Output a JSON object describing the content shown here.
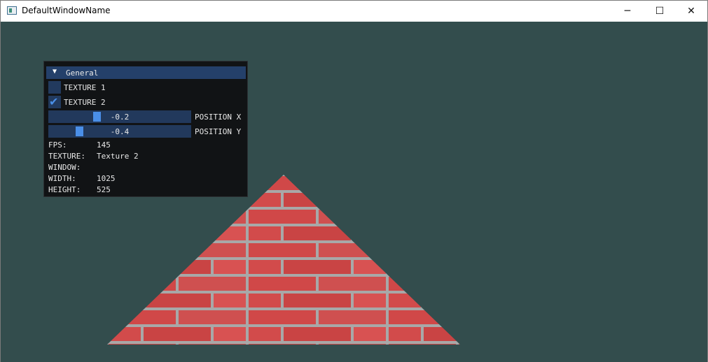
{
  "window": {
    "title": "DefaultWindowName",
    "min_glyph": "─",
    "max_glyph": "☐",
    "close_glyph": "✕"
  },
  "scene": {
    "background_color": "#334d4d",
    "object": "red brick textured triangle"
  },
  "gui": {
    "header": {
      "arrow": "▼",
      "label": "General"
    },
    "checkboxes": [
      {
        "label": "TEXTURE 1",
        "checked": false
      },
      {
        "label": "TEXTURE 2",
        "checked": true,
        "glyph": "✔"
      }
    ],
    "sliders": [
      {
        "label": "POSITION X",
        "value_text": "-0.2",
        "value": -0.2,
        "min": -1,
        "max": 1
      },
      {
        "label": "POSITION Y",
        "value_text": "-0.4",
        "value": -0.4,
        "min": -1,
        "max": 1
      }
    ],
    "stats": [
      {
        "key": "FPS:",
        "value": "145"
      },
      {
        "key": "TEXTURE:",
        "value": "Texture 2"
      },
      {
        "key": "WINDOW:",
        "value": ""
      },
      {
        "key": "WIDTH:",
        "value": "1025"
      },
      {
        "key": "HEIGHT:",
        "value": "525"
      }
    ]
  },
  "colors": {
    "accent": "#4a8fe8",
    "frame": "#223a5e",
    "header": "#24406a",
    "brick": "#d04848",
    "mortar": "#a8a8a8"
  }
}
